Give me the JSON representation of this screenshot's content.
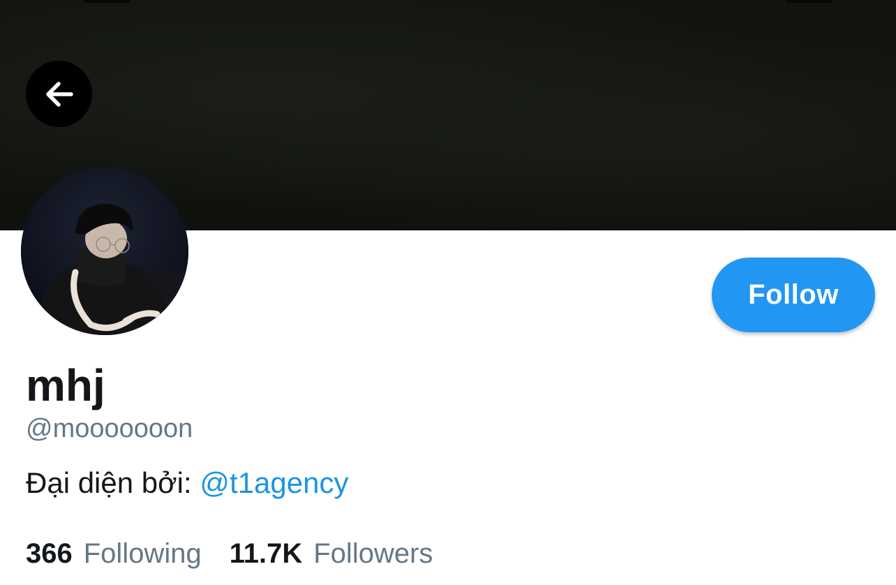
{
  "profile": {
    "display_name": "mhj",
    "handle": "@mooooooon",
    "bio_prefix": "Đại diện bởi:",
    "bio_mention": "@t1agency"
  },
  "actions": {
    "follow_label": "Follow",
    "back_icon": "arrow-left-icon"
  },
  "stats": {
    "following_count": "366",
    "following_label": "Following",
    "followers_count": "11.7K",
    "followers_label": "Followers"
  },
  "colors": {
    "accent": "#2196f3",
    "mention": "#1b95e0",
    "muted_text": "#657786",
    "primary_text": "#14171a",
    "banner": "#121410"
  }
}
